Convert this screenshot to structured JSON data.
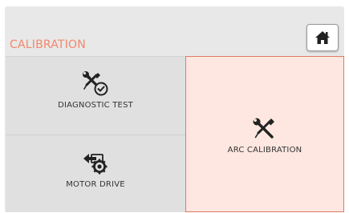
{
  "header": {
    "title": "CALIBRATION",
    "home_icon": "home-icon"
  },
  "tiles": [
    {
      "id": "diagnostic-test",
      "label": "DIAGNOSTIC TEST",
      "icon": "wrench-screwdriver-check-icon",
      "selected": false
    },
    {
      "id": "motor-drive",
      "label": "MOTOR DRIVE",
      "icon": "motor-gear-arrow-icon",
      "selected": false
    },
    {
      "id": "arc-calibration",
      "label": "ARC CALIBRATION",
      "icon": "wrench-screwdriver-icon",
      "selected": true
    }
  ],
  "colors": {
    "title": "#f2876b",
    "selected_bg": "#fde7e0",
    "selected_border": "#e07a60",
    "tile_bg": "#e0e0e0",
    "icon": "#222222"
  }
}
